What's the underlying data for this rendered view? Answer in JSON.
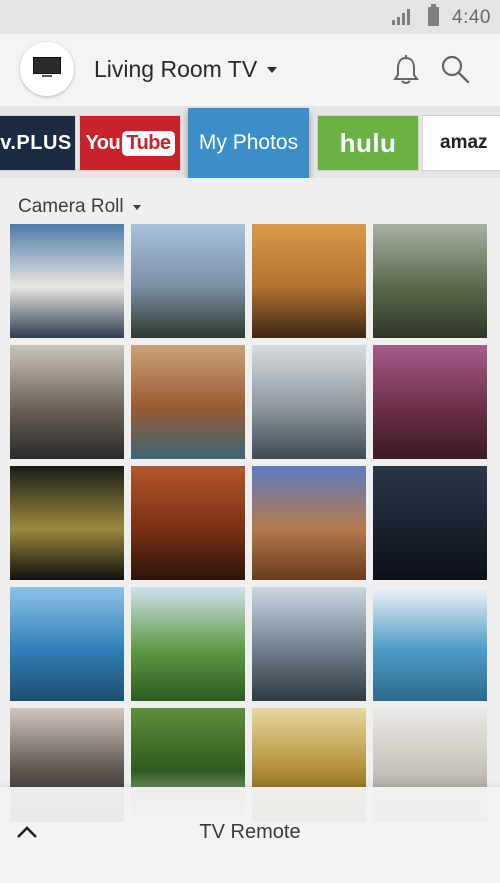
{
  "status_bar": {
    "time": "4:40",
    "signal_icon": "cellular-signal-icon",
    "battery_icon": "battery-icon"
  },
  "header": {
    "device_name": "Living Room TV",
    "avatar_icon": "tv-icon",
    "notifications_icon": "bell-icon",
    "search_icon": "search-icon"
  },
  "apps": [
    {
      "id": "vplus",
      "label": "v.PLUS"
    },
    {
      "id": "youtube",
      "label_you": "You",
      "label_tube": "Tube"
    },
    {
      "id": "my-photos",
      "label": "My Photos",
      "selected": true
    },
    {
      "id": "hulu",
      "label": "hulu"
    },
    {
      "id": "amazon",
      "label": "amaz"
    }
  ],
  "album": {
    "title": "Camera Roll"
  },
  "photos": [
    {
      "name": "marina-boats",
      "colors": [
        "#4d7ca8",
        "#e9e6e1",
        "#2f3c4e"
      ]
    },
    {
      "name": "sky-clouds-valley",
      "colors": [
        "#a9c1dc",
        "#7b8fa6",
        "#2d3a2c"
      ]
    },
    {
      "name": "golden-gate-tower-sunset",
      "colors": [
        "#d89a4a",
        "#b47230",
        "#3c2612"
      ]
    },
    {
      "name": "forest-road",
      "colors": [
        "#a6b1a3",
        "#5a6a4c",
        "#2e3626"
      ]
    },
    {
      "name": "wedding-bouquet",
      "colors": [
        "#c9c4b9",
        "#6b635a",
        "#2c2a28"
      ]
    },
    {
      "name": "horseshoe-bend",
      "colors": [
        "#c9a278",
        "#9a5b34",
        "#3c6677"
      ]
    },
    {
      "name": "bridge-fog",
      "colors": [
        "#d8dcdf",
        "#8d969c",
        "#3d4a54"
      ]
    },
    {
      "name": "antelope-canyon-purple",
      "colors": [
        "#a35d8a",
        "#6d2f4a",
        "#3b1924"
      ]
    },
    {
      "name": "big-ben-night",
      "colors": [
        "#1b1c1a",
        "#9b8a3d",
        "#0f0f0f"
      ]
    },
    {
      "name": "canyon-light",
      "colors": [
        "#b3572d",
        "#7a3014",
        "#2d140a"
      ]
    },
    {
      "name": "monument-valley",
      "colors": [
        "#5e7bc4",
        "#b47a4a",
        "#6a3a20"
      ]
    },
    {
      "name": "night-sky",
      "colors": [
        "#2a3746",
        "#1a2230",
        "#0c1018"
      ]
    },
    {
      "name": "coast-bay",
      "colors": [
        "#8ec2e8",
        "#2f7fb9",
        "#1d4f6f"
      ]
    },
    {
      "name": "jungle-hills",
      "colors": [
        "#cfe0ee",
        "#5f9a43",
        "#2d5a22"
      ]
    },
    {
      "name": "tower-bridge",
      "colors": [
        "#cbd8e4",
        "#6f7f8c",
        "#2f3a42"
      ]
    },
    {
      "name": "island-aerial",
      "colors": [
        "#f1f3f6",
        "#4d9ac8",
        "#2c6b8a"
      ]
    },
    {
      "name": "record-player",
      "colors": [
        "#cfc6bd",
        "#5d5550",
        "#222"
      ]
    },
    {
      "name": "waterfall-moss",
      "colors": [
        "#5f8f3d",
        "#2f5a1e",
        "#d5e5d6"
      ]
    },
    {
      "name": "sunflower-field",
      "colors": [
        "#e8d8a0",
        "#b08d38",
        "#5b4512"
      ]
    },
    {
      "name": "stacked-plates",
      "colors": [
        "#eceae6",
        "#c6c2bb",
        "#8a867f"
      ]
    }
  ],
  "bottom_bar": {
    "label": "TV Remote",
    "toggle_icon": "chevron-up-icon"
  }
}
